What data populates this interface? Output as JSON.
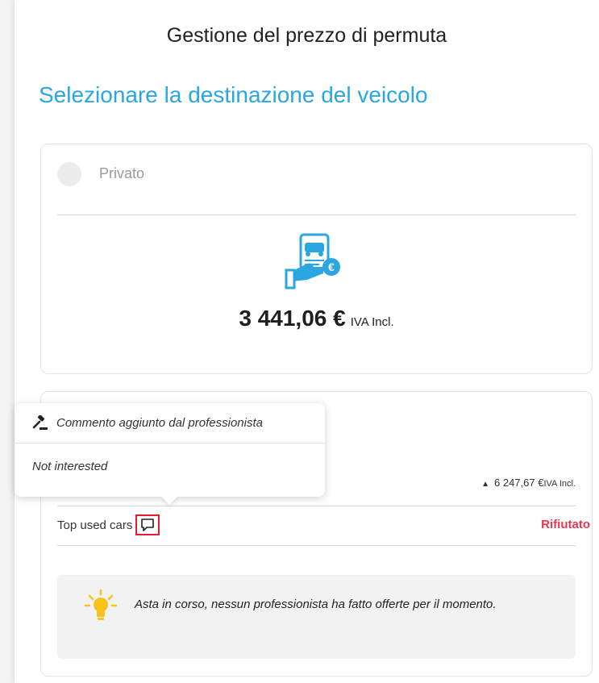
{
  "page": {
    "title": "Gestione del prezzo di permuta",
    "subtitle": "Selezionare la destinazione del veicolo"
  },
  "private_option": {
    "label": "Privato",
    "selected": false,
    "price": "3 441,06 €",
    "vat_label": "IVA Incl.",
    "icon": "car-document-euro-icon"
  },
  "professional": {
    "best_price": "6 247,67 €",
    "vat_label": "IVA Incl.",
    "trend_icon": "triangle-up-icon",
    "bidder_name": "Top used cars",
    "bidder_status": "Rifiutato",
    "comment_icon": "comment-icon",
    "info_message": "Asta in corso, nessun professionista ha fatto offerte per il momento.",
    "info_icon": "lightbulb-icon"
  },
  "tooltip": {
    "icon": "gavel-icon",
    "title": "Commento aggiunto dal professionista",
    "comment": "Not interested"
  },
  "colors": {
    "accent_blue": "#2aa6e0",
    "rejected_red": "#e8364f",
    "highlight_red": "#e51e2f",
    "bulb_yellow": "#f7c21b"
  }
}
